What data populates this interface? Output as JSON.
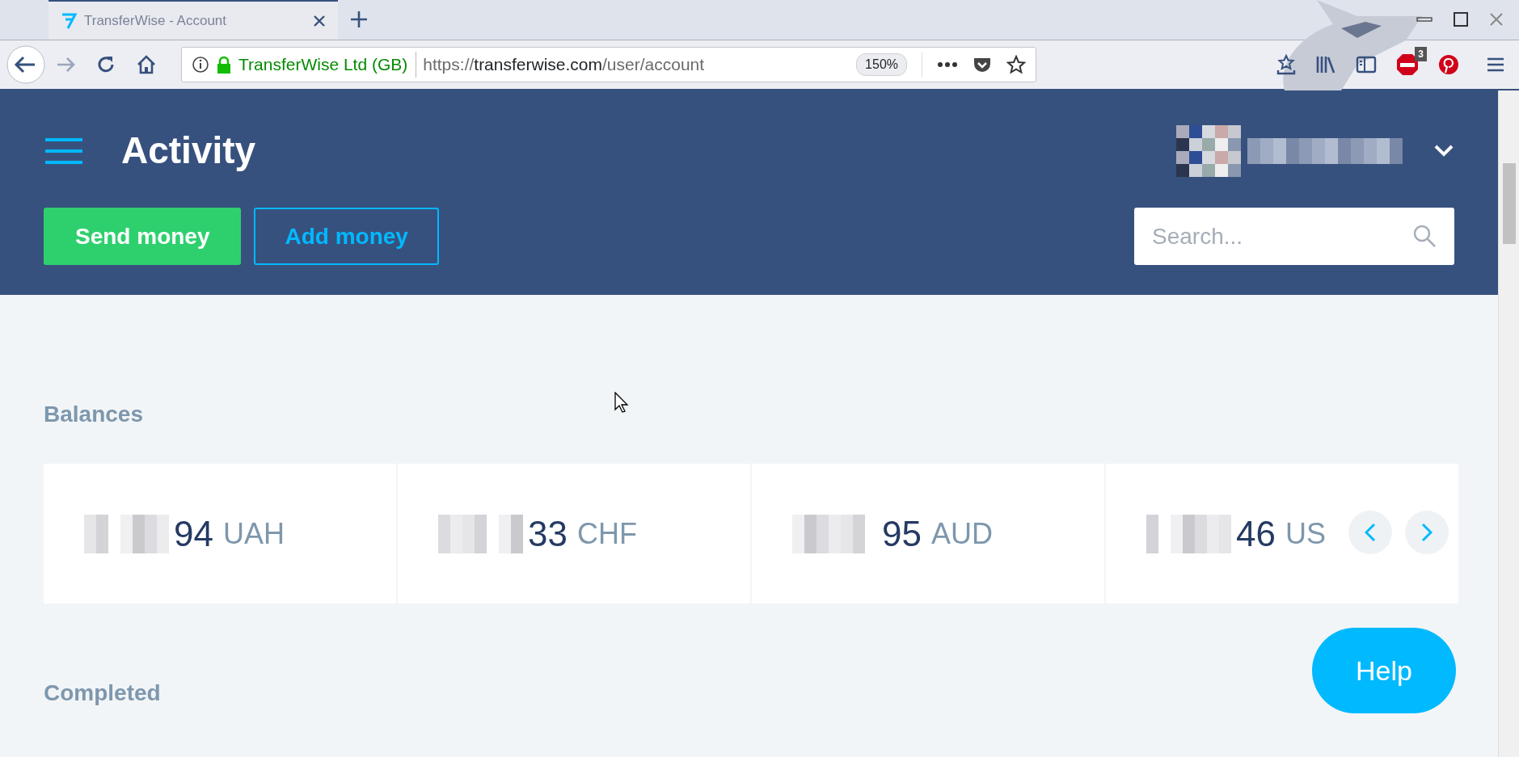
{
  "browser": {
    "tab": {
      "title": "TransferWise - Account",
      "selected": true
    },
    "site_identity": "TransferWise Ltd (GB)",
    "url": {
      "scheme": "https://",
      "host": "transferwise.com",
      "path": "/user/account"
    },
    "zoom": "150%",
    "adblock_count": "3"
  },
  "header": {
    "title": "Activity",
    "buttons": [
      {
        "label": "Send money",
        "kind": "primary"
      },
      {
        "label": "Add money",
        "kind": "outline"
      }
    ],
    "search": {
      "placeholder": "Search..."
    }
  },
  "balances": {
    "heading": "Balances",
    "items": [
      {
        "amount": "94",
        "currency": "UAH"
      },
      {
        "amount": "33",
        "currency": "CHF"
      },
      {
        "amount": "95",
        "currency": "AUD"
      },
      {
        "amount": "46",
        "currency": "US"
      }
    ]
  },
  "help": "Help",
  "completed": {
    "heading": "Completed"
  }
}
